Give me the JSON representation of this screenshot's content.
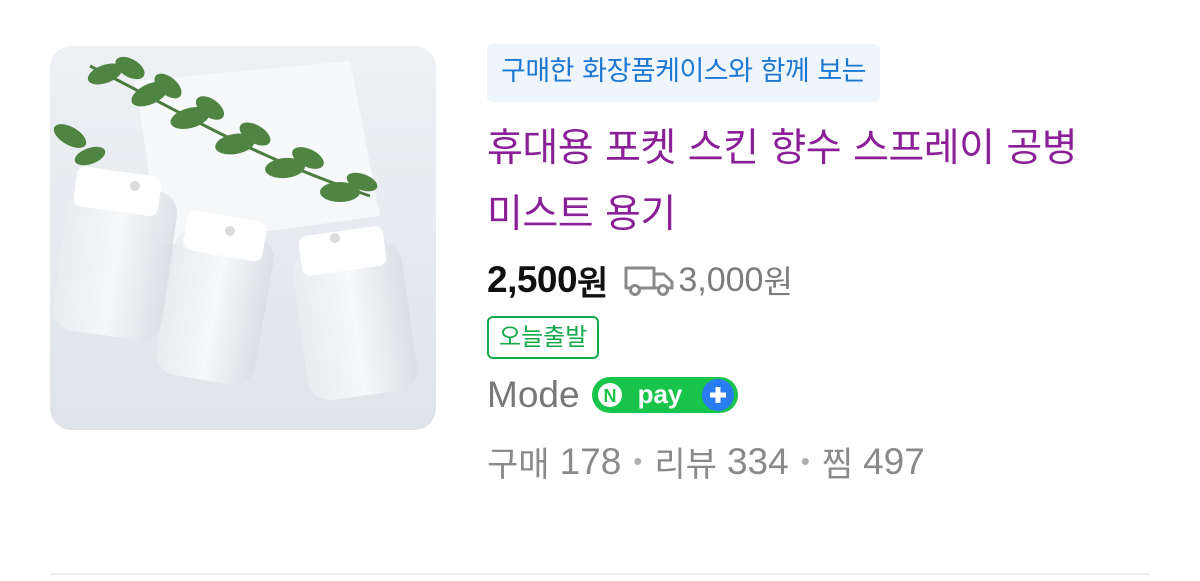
{
  "product": {
    "banner": "구매한 화장품케이스와 함께 보는",
    "title": "휴대용 포켓 스킨 향수 스프레이 공병 미스트 용기",
    "price": "2,500",
    "price_unit": "원",
    "shipping_fee": "3,000",
    "shipping_unit": "원",
    "delivery_badge": "오늘출발",
    "seller": "Mode",
    "npay_label": "pay",
    "stats": {
      "purchase_label": "구매",
      "purchase_count": "178",
      "review_label": "리뷰",
      "review_count": "334",
      "wish_label": "찜",
      "wish_count": "497",
      "separator": "•"
    }
  },
  "icons": {
    "thumbnail": "product-thumbnail-image",
    "shipping": "truck-icon",
    "npay": "npay-plus-icon"
  },
  "colors": {
    "banner_text": "#1e78d2",
    "banner_bg": "#eef5fd",
    "title": "#8a1f97",
    "delivery_badge": "#13a84b",
    "npay_green": "#18c44a",
    "npay_blue": "#2a7df0"
  }
}
